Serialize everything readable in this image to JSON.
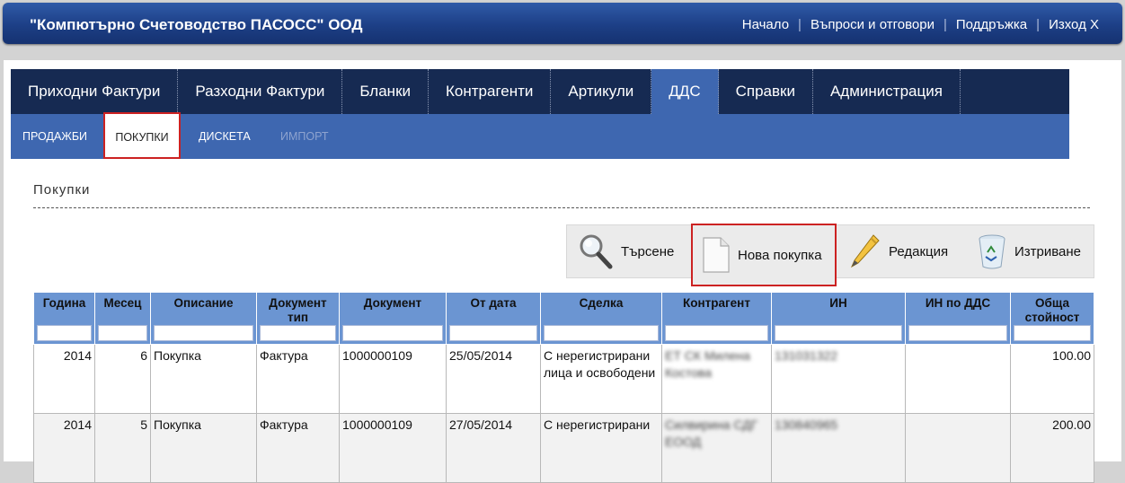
{
  "header": {
    "company": "\"Компютърно Счетоводство ПАСОСС\" ООД",
    "links": [
      "Начало",
      "Въпроси и отговори",
      "Поддръжка",
      "Изход X"
    ]
  },
  "main_nav": {
    "tabs": [
      "Приходни Фактури",
      "Разходни Фактури",
      "Бланки",
      "Контрагенти",
      "Артикули",
      "ДДС",
      "Справки",
      "Администрация"
    ],
    "active": "ДДС"
  },
  "sub_nav": {
    "items": [
      "ПРОДАЖБИ",
      "ПОКУПКИ",
      "ДИСКЕТА",
      "ИМПОРТ"
    ],
    "active": "ПОКУПКИ",
    "disabled": "ИМПОРТ"
  },
  "page_title": "Покупки",
  "toolbar": {
    "search": "Търсене",
    "new": "Нова покупка",
    "edit": "Редакция",
    "delete": "Изтриване"
  },
  "table": {
    "columns": [
      "Година",
      "Месец",
      "Описание",
      "Документ тип",
      "Документ",
      "От дата",
      "Сделка",
      "Контрагент",
      "ИН",
      "ИН по ДДС",
      "Обща стойност"
    ],
    "rows": [
      [
        "2014",
        "6",
        "Покупка",
        "Фактура",
        "1000000109",
        "25/05/2014",
        "С нерегистрирани лица и освободени",
        "ЕТ СК Милена Костова",
        "131031322",
        "",
        "100.00"
      ],
      [
        "2014",
        "5",
        "Покупка",
        "Фактура",
        "1000000109",
        "27/05/2014",
        "С нерегистрирани",
        "Силвирина СДГ ЕООД",
        "130840965",
        "",
        "200.00"
      ]
    ]
  },
  "colors": {
    "header_bg": "#1d3f86",
    "nav_bg": "#162a52",
    "subnav_bg": "#3e67b0",
    "table_header_bg": "#6b95d2",
    "highlight": "#cc2222"
  },
  "icons": [
    "magnifier-icon",
    "document-icon",
    "pencil-icon",
    "recycle-bin-icon"
  ]
}
